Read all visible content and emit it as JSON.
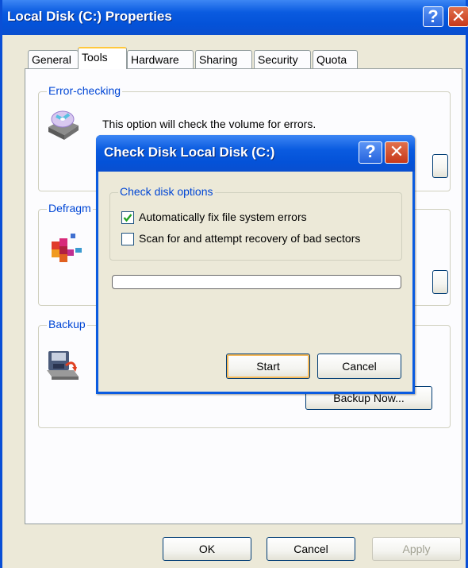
{
  "window": {
    "title": "Local Disk (C:) Properties",
    "help_glyph": "?",
    "close_glyph": "✕"
  },
  "tabs": [
    {
      "label": "General"
    },
    {
      "label": "Tools",
      "active": true
    },
    {
      "label": "Hardware"
    },
    {
      "label": "Sharing"
    },
    {
      "label": "Security"
    },
    {
      "label": "Quota"
    }
  ],
  "sections": {
    "error_checking": {
      "label": "Error-checking",
      "description": "This option will check the volume for errors."
    },
    "defrag": {
      "label": "Defragm"
    },
    "backup": {
      "label": "Backup",
      "button": "Backup Now..."
    }
  },
  "buttons": {
    "ok": "OK",
    "cancel": "Cancel",
    "apply": "Apply"
  },
  "dialog": {
    "title": "Check Disk Local Disk (C:)",
    "group_label": "Check disk options",
    "options": [
      {
        "label": "Automatically fix file system errors",
        "checked": true
      },
      {
        "label": "Scan for and attempt recovery of bad sectors",
        "checked": false
      }
    ],
    "progress": 0,
    "start": "Start",
    "cancel": "Cancel"
  },
  "icons": [
    "disk-check-icon",
    "defragment-icon",
    "backup-icon",
    "help-icon",
    "close-icon",
    "checkmark-icon"
  ],
  "colors": {
    "titlebar": "#0a5be0",
    "group_label": "#0046d5",
    "face": "#ece9d8"
  }
}
